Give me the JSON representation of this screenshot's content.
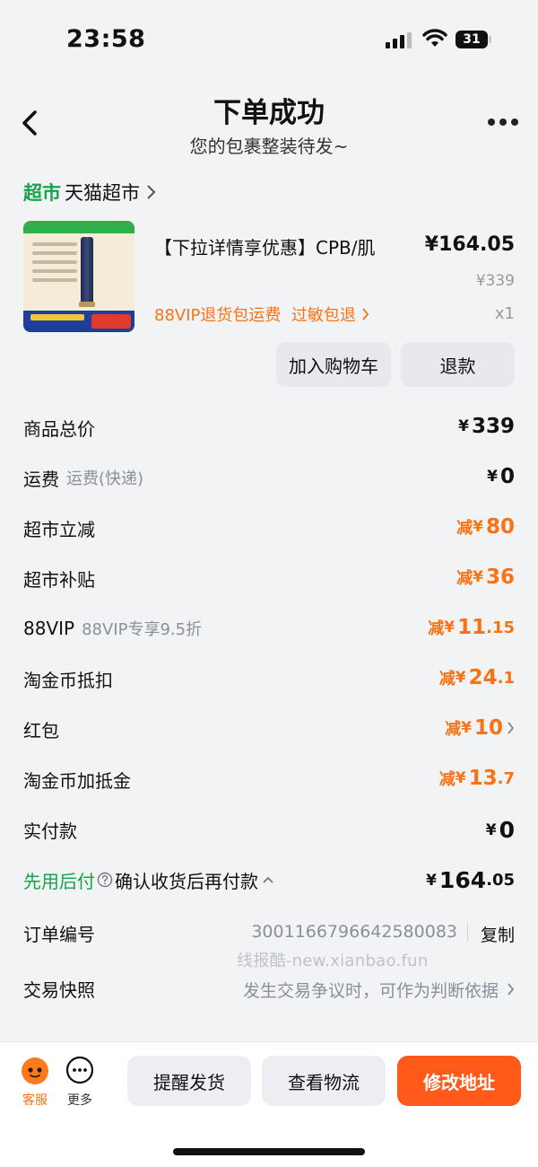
{
  "status_bar": {
    "time": "23:58",
    "battery": "31"
  },
  "header": {
    "title": "下单成功",
    "subtitle": "您的包裹整装待发~"
  },
  "store": {
    "badge": "超市",
    "name": "天猫超市"
  },
  "product": {
    "title": "【下拉详情享优惠】CPB/肌",
    "price": "¥164.05",
    "original_price": "¥339",
    "tags": "88VIP退货包运费  过敏包退",
    "quantity": "x1",
    "add_to_cart": "加入购物车",
    "refund": "退款"
  },
  "summary": {
    "total": {
      "label": "商品总价",
      "yen": "¥",
      "value": "339"
    },
    "shipping": {
      "label": "运费",
      "sub": "运费(快递)",
      "yen": "¥",
      "value": "0"
    },
    "discount_market": {
      "label": "超市立减",
      "prefix": "减",
      "yen": "¥",
      "value": "80"
    },
    "subsidy_market": {
      "label": "超市补贴",
      "prefix": "减",
      "yen": "¥",
      "value": "36"
    },
    "vip": {
      "label": "88VIP",
      "sub": "88VIP专享9.5折",
      "prefix": "减",
      "yen": "¥",
      "value_int": "11",
      "value_dec": ".15"
    },
    "coin_deduct": {
      "label": "淘金币抵扣",
      "prefix": "减",
      "yen": "¥",
      "value_int": "24",
      "value_dec": ".1"
    },
    "red_packet": {
      "label": "红包",
      "prefix": "减",
      "yen": "¥",
      "value": "10"
    },
    "coin_bonus": {
      "label": "淘金币加抵金",
      "prefix": "减",
      "yen": "¥",
      "value_int": "13",
      "value_dec": ".7"
    },
    "paid": {
      "label": "实付款",
      "yen": "¥",
      "value": "0"
    },
    "pay_later": {
      "label": "先用后付",
      "desc": "确认收货后再付款",
      "yen": "¥",
      "value_int": "164",
      "value_dec": ".05"
    }
  },
  "order": {
    "number_label": "订单编号",
    "number": "3001166796642580083",
    "copy": "复制",
    "watermark": "线报酷-new.xianbao.fun",
    "snapshot_label": "交易快照",
    "snapshot_desc": "发生交易争议时，可作为判断依据"
  },
  "bottom": {
    "service": "客服",
    "more": "更多",
    "remind": "提醒发货",
    "logistics": "查看物流",
    "change_address": "修改地址"
  },
  "colors": {
    "accent": "#ff5a1a",
    "discount": "#f97316",
    "green": "#16a34a"
  }
}
